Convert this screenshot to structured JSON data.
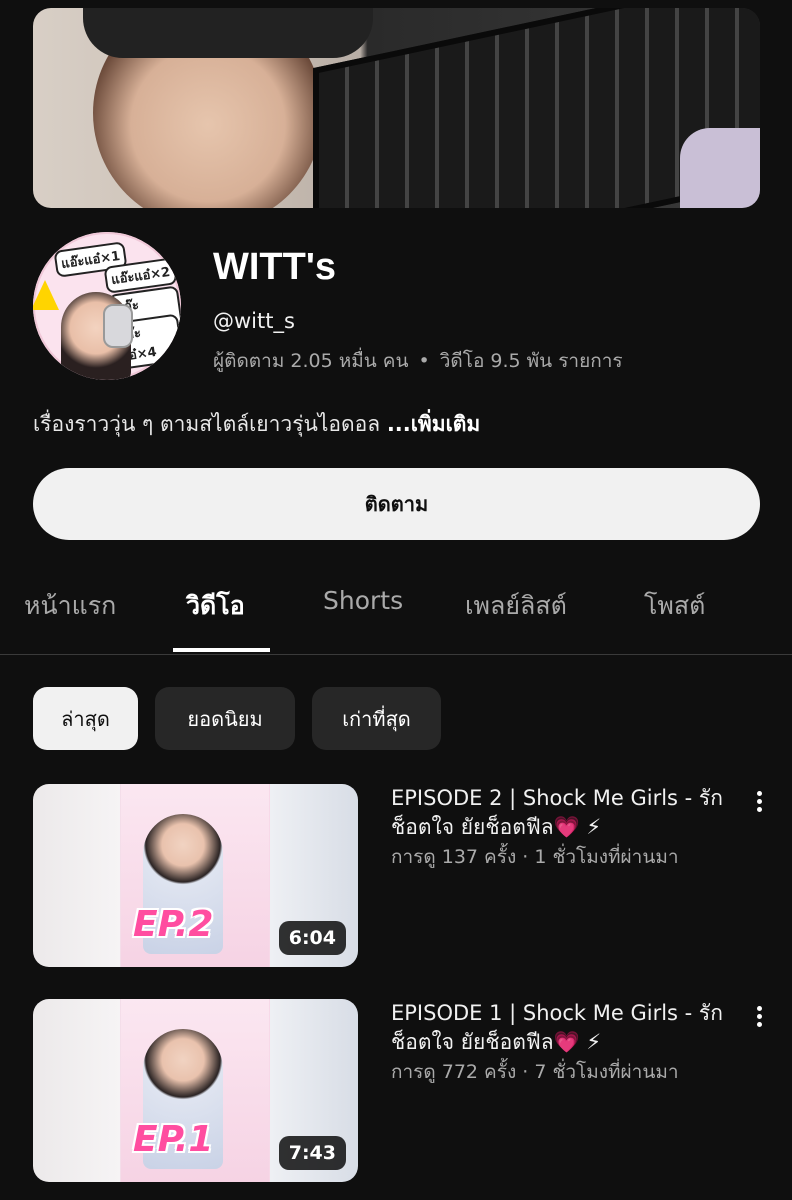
{
  "channel": {
    "name": "WITT's",
    "handle": "@witt_s",
    "subscribers": "ผู้ติดตาม 2.05 หมื่น คน",
    "separator": "•",
    "videos_count": "วิดีโอ 9.5 พัน รายการ",
    "description": "เรื่องราววุ่น ๆ ตามสไตล์เยาวรุ่นไอดอล",
    "more_label": "...เพิ่มเติม",
    "avatar_text": [
      "แอ๊ะแอ๋×1",
      "แอ๊ะแอ๋×2",
      "แอ๊ะแอ๋×3",
      "แอ๊ะแอ๋×4"
    ]
  },
  "subscribe_label": "ติดตาม",
  "tabs": [
    {
      "label": "หน้าแรก",
      "active": false
    },
    {
      "label": "วิดีโอ",
      "active": true
    },
    {
      "label": "Shorts",
      "active": false
    },
    {
      "label": "เพลย์ลิสต์",
      "active": false
    },
    {
      "label": "โพสต์",
      "active": false
    }
  ],
  "filters": [
    {
      "label": "ล่าสุด",
      "active": true
    },
    {
      "label": "ยอดนิยม",
      "active": false
    },
    {
      "label": "เก่าที่สุด",
      "active": false
    }
  ],
  "videos": [
    {
      "title": "EPISODE 2 | Shock Me Girls - รักช็อตใจ ยัยช็อตฟีล💗 ⚡",
      "views": "การดู 137 ครั้ง",
      "dot": "·",
      "time": "1 ชั่วโมงที่ผ่านมา",
      "duration": "6:04",
      "thumb_label": "EP.2"
    },
    {
      "title": "EPISODE 1 | Shock Me Girls - รักช็อตใจ ยัยช็อตฟีล💗 ⚡",
      "views": "การดู 772 ครั้ง",
      "dot": "·",
      "time": "7 ชั่วโมงที่ผ่านมา",
      "duration": "7:43",
      "thumb_label": "EP.1"
    }
  ],
  "colors": {
    "background": "#0f0f0f",
    "chip": "#272727",
    "chip_active": "#f1f1f1",
    "secondary_text": "#aaaaaa",
    "thumb_accent": "#ff4da0"
  }
}
